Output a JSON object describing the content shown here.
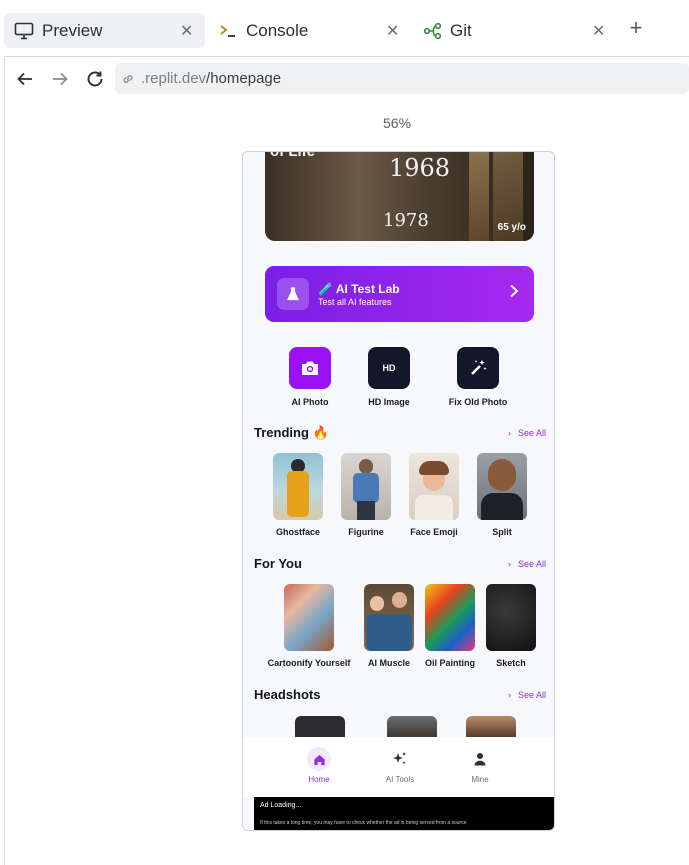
{
  "tabs": [
    {
      "label": "Preview",
      "icon": "monitor-icon",
      "active": true
    },
    {
      "label": "Console",
      "icon": "terminal-icon",
      "active": false
    },
    {
      "label": "Git",
      "icon": "git-branch-icon",
      "active": false
    }
  ],
  "browser": {
    "url_host": ".replit.dev",
    "url_path": "/homepage",
    "zoom": "56%"
  },
  "app": {
    "hero": {
      "year_top": "1968",
      "year_bottom": "1978",
      "age_label": "65 y/o",
      "partial_text": "of Life"
    },
    "banner": {
      "title": "🧪 AI Test Lab",
      "subtitle": "Test all AI features"
    },
    "tools": [
      {
        "label": "AI Photo",
        "icon": "camera-icon",
        "color": "#9a12f5"
      },
      {
        "label": "HD Image",
        "icon": "hd-icon",
        "color": "#12182a"
      },
      {
        "label": "Fix Old Photo",
        "icon": "magic-wand-icon",
        "color": "#12182a"
      }
    ],
    "sections": {
      "trending": {
        "title": "Trending 🔥",
        "see_all": "See All",
        "items": [
          "Ghostface",
          "Figurine",
          "Face Emoji",
          "Split"
        ]
      },
      "for_you": {
        "title": "For You",
        "see_all": "See All",
        "items": [
          "Cartoonify Yourself",
          "AI Muscle",
          "Oil Painting",
          "Sketch"
        ]
      },
      "headshots": {
        "title": "Headshots",
        "see_all": "See All"
      }
    },
    "tabbar": [
      {
        "label": "Home",
        "icon": "home-icon",
        "active": true
      },
      {
        "label": "AI Tools",
        "icon": "sparkles-icon",
        "active": false
      },
      {
        "label": "Mine",
        "icon": "user-icon",
        "active": false
      }
    ],
    "ad": {
      "title": "Ad Loading...",
      "subtitle": "If this takes a long time, you may have to check whether the ad is being served from a source"
    }
  },
  "colors": {
    "accent": "#8e2de2",
    "banner_start": "#7a1fe6",
    "banner_end": "#a629f0",
    "dark_tile": "#12182a"
  }
}
